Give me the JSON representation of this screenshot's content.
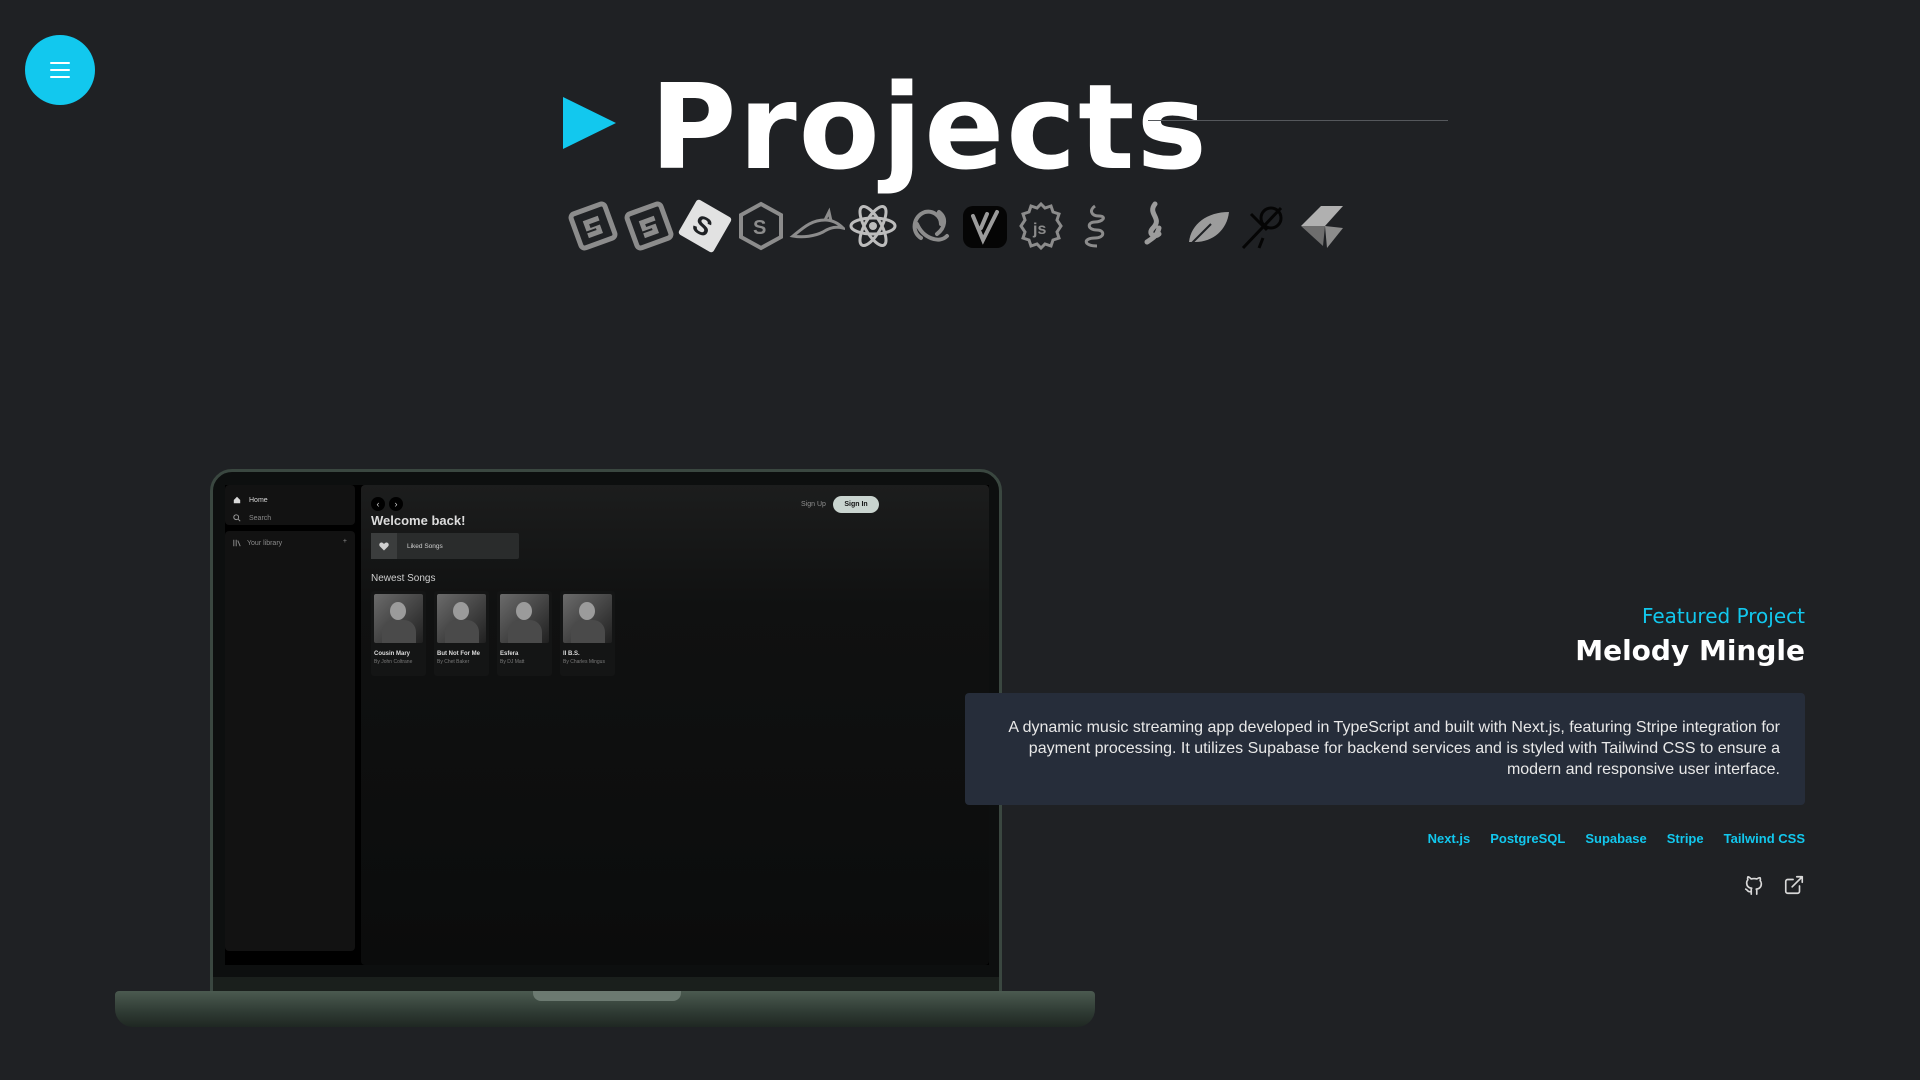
{
  "page": {
    "title": "Projects",
    "accent_color": "#12c8ee",
    "background_color": "#1f2124"
  },
  "nav": {
    "menu_icon": "hamburger-menu-icon"
  },
  "tech_icons": [
    "html5-icon",
    "css3-icon",
    "svelte-icon",
    "sass-icon",
    "mysql-dolphin-icon",
    "react-icon",
    "redux-icon",
    "vite-icon",
    "nodejs-icon",
    "nestjs-icon",
    "java-icon",
    "mongodb-leaf-icon",
    "expressjs-icon",
    "framer-icon"
  ],
  "laptop_app": {
    "sidebar": {
      "home_label": "Home",
      "search_label": "Search",
      "library_label": "Your library",
      "library_add": "+"
    },
    "header": {
      "back": "‹",
      "forward": "›",
      "signup_label": "Sign Up",
      "signin_label": "Sign In"
    },
    "welcome": "Welcome back!",
    "liked_songs": "Liked Songs",
    "newest_title": "Newest Songs",
    "songs": [
      {
        "title": "Cousin Mary",
        "artist": "By John Coltrane"
      },
      {
        "title": "But Not For Me",
        "artist": "By Chet Baker"
      },
      {
        "title": "Esfera",
        "artist": "By DJ Matt"
      },
      {
        "title": "II B.S.",
        "artist": "By Charles Mingus"
      }
    ]
  },
  "project": {
    "label": "Featured Project",
    "name": "Melody Mingle",
    "description": "A dynamic music streaming app developed in TypeScript and built with Next.js, featuring Stripe integration for payment processing. It utilizes Supabase for backend services and is styled with Tailwind CSS to ensure a modern and responsive user interface.",
    "tags": [
      "Next.js",
      "PostgreSQL",
      "Supabase",
      "Stripe",
      "Tailwind CSS"
    ],
    "links": [
      "github-icon",
      "external-link-icon"
    ]
  }
}
